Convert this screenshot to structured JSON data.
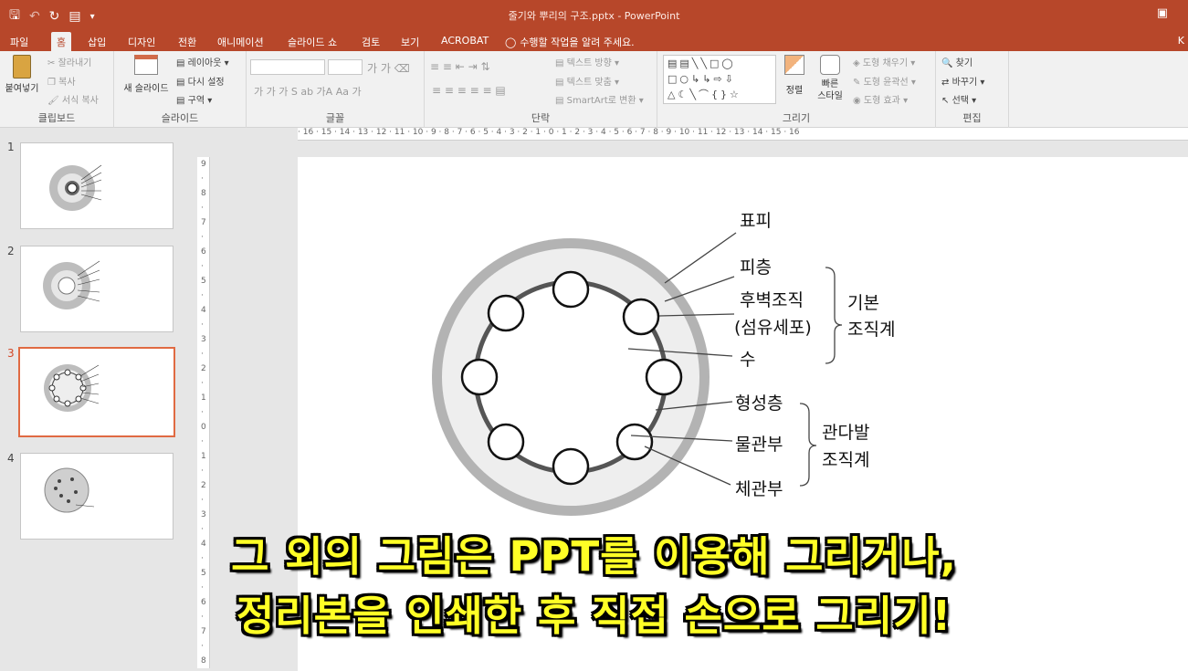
{
  "window": {
    "title": "줄기와 뿌리의 구조.pptx - PowerPoint",
    "qat": [
      "save-icon",
      "undo-icon",
      "redo-icon",
      "presenter-icon",
      "customize-icon"
    ]
  },
  "tabs": [
    {
      "label": "파일",
      "active": false
    },
    {
      "label": "홈",
      "active": true
    },
    {
      "label": "삽입",
      "active": false
    },
    {
      "label": "디자인",
      "active": false
    },
    {
      "label": "전환",
      "active": false
    },
    {
      "label": "애니메이션",
      "active": false
    },
    {
      "label": "슬라이드 쇼",
      "active": false
    },
    {
      "label": "검토",
      "active": false
    },
    {
      "label": "보기",
      "active": false
    },
    {
      "label": "ACROBAT",
      "active": false
    }
  ],
  "tell_me": "수행할 작업을 알려 주세요.",
  "account_initial": "K",
  "ribbon": {
    "clipboard": {
      "paste": "붙여넣기",
      "cut": "잘라내기",
      "copy": "복사",
      "format_painter": "서식 복사",
      "label": "클립보드"
    },
    "slides": {
      "new_slide": "새 슬라이드",
      "layout": "레이아웃",
      "reset": "다시 설정",
      "section": "구역",
      "label": "슬라이드"
    },
    "font": {
      "label": "글꼴",
      "row2": "가  가  가  S  ab  가A  Aa  가"
    },
    "paragraph": {
      "label": "단락",
      "text_direction": "텍스트 방향",
      "align_text": "텍스트 맞춤",
      "smartart": "SmartArt로 변환"
    },
    "drawing": {
      "label": "그리기",
      "arrange": "정렬",
      "quick_styles": "빠른 스타일",
      "shape_fill": "도형 채우기",
      "shape_outline": "도형 윤곽선",
      "shape_effects": "도형 효과"
    },
    "editing": {
      "label": "편집",
      "find": "찾기",
      "replace": "바꾸기",
      "select": "선택"
    }
  },
  "ruler_h": "· 16 · 15 · 14 · 13 · 12 · 11 · 10 · 9 · 8 · 7 · 6 · 5 · 4 · 3 · 2 · 1 · 0 · 1 · 2 · 3 · 4 · 5 · 6 · 7 · 8 · 9 · 10 · 11 · 12 · 13 · 14 · 15 · 16",
  "slides": [
    {
      "number": "1",
      "active": false
    },
    {
      "number": "2",
      "active": false
    },
    {
      "number": "3",
      "active": true
    },
    {
      "number": "4",
      "active": false
    }
  ],
  "slide_content": {
    "labels": {
      "epidermis": "표피",
      "cortex": "피층",
      "sclerenchyma": "후벽조직",
      "fiber_cell": "(섬유세포)",
      "pith": "수",
      "cambium": "형성층",
      "xylem": "물관부",
      "phloem": "체관부"
    },
    "groups": {
      "ground_tissue_1": "기본",
      "ground_tissue_2": "조직계",
      "vascular_tissue_1": "관다발",
      "vascular_tissue_2": "조직계"
    }
  },
  "caption": {
    "line1": "그 외의 그림은 PPT를 이용해 그리거나,",
    "line2": "정리본을 인쇄한 후 직접 손으로 그리기!"
  },
  "colors": {
    "accent": "#b7472a",
    "caption_text": "#ffff26",
    "outer_ring": "#b3b3b3",
    "inner_disk": "#eeeeee"
  }
}
